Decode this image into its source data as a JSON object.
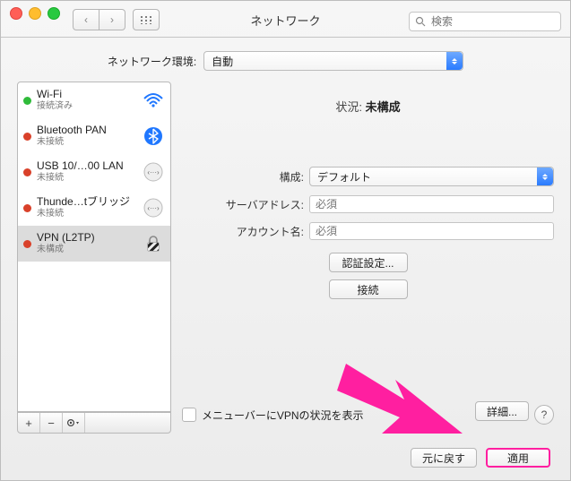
{
  "window": {
    "title": "ネットワーク"
  },
  "search": {
    "placeholder": "検索"
  },
  "location": {
    "label": "ネットワーク環境:",
    "value": "自動"
  },
  "services": [
    {
      "name": "Wi-Fi",
      "status": "接続済み",
      "dot": "green",
      "icon": "wifi",
      "selected": false
    },
    {
      "name": "Bluetooth PAN",
      "status": "未接続",
      "dot": "red",
      "icon": "bluetooth",
      "selected": false
    },
    {
      "name": "USB 10/…00 LAN",
      "status": "未接続",
      "dot": "red",
      "icon": "ethernet",
      "selected": false
    },
    {
      "name": "Thunde…tブリッジ",
      "status": "未接続",
      "dot": "red",
      "icon": "ethernet",
      "selected": false
    },
    {
      "name": "VPN (L2TP)",
      "status": "未構成",
      "dot": "red",
      "icon": "lock",
      "selected": true
    }
  ],
  "toolbar": {
    "add": "+",
    "remove": "−",
    "action": "✻▾"
  },
  "detail": {
    "status_label": "状況:",
    "status_value": "未構成",
    "config_label": "構成:",
    "config_value": "デフォルト",
    "server_label": "サーバアドレス:",
    "server_placeholder": "必須",
    "account_label": "アカウント名:",
    "account_placeholder": "必須",
    "auth_button": "認証設定...",
    "connect_button": "接続",
    "menubar_checkbox": "メニューバーにVPNの状況を表示",
    "details_button": "詳細...",
    "help": "?"
  },
  "footer": {
    "revert": "元に戻す",
    "apply": "適用"
  }
}
